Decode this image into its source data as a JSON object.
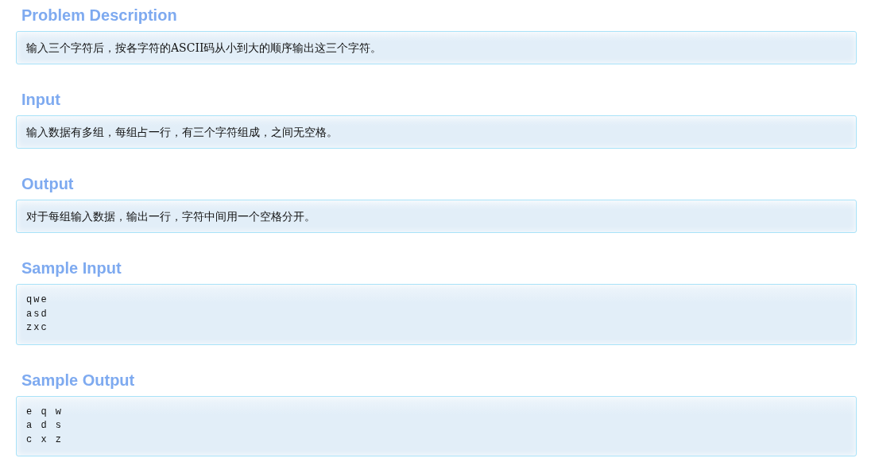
{
  "sections": [
    {
      "heading": "Problem Description",
      "kind": "text",
      "body": "输入三个字符后，按各字符的ASCII码从小到大的顺序输出这三个字符。"
    },
    {
      "heading": "Input",
      "kind": "text",
      "body": "输入数据有多组，每组占一行，有三个字符组成，之间无空格。"
    },
    {
      "heading": "Output",
      "kind": "text",
      "body": "对于每组输入数据，输出一行，字符中间用一个空格分开。"
    },
    {
      "heading": "Sample Input",
      "kind": "code",
      "body": "qwe\nasd\nzxc"
    },
    {
      "heading": "Sample Output",
      "kind": "code",
      "body": "e q w\na d s\nc x z"
    }
  ]
}
